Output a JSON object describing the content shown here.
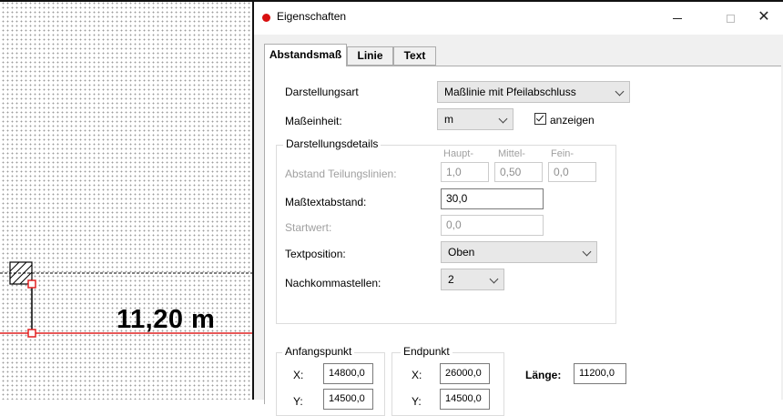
{
  "canvas": {
    "dimension_text": "11,20 m"
  },
  "dialog": {
    "title": "Eigenschaften",
    "icon": "red-dot-icon",
    "window_buttons": {
      "minimize": "–",
      "maximize": "□",
      "close": "✕"
    },
    "tabs": [
      {
        "label": "Abstandsmaß",
        "selected": true
      },
      {
        "label": "Linie",
        "selected": false
      },
      {
        "label": "Text",
        "selected": false
      }
    ],
    "darstellungsart": {
      "label": "Darstellungsart",
      "value": "Maßlinie mit Pfeilabschluss"
    },
    "masseinheit": {
      "label": "Maßeinheit:",
      "value": "m",
      "anzeigen_label": "anzeigen",
      "anzeigen_checked": true
    },
    "details": {
      "title": "Darstellungsdetails",
      "headers": {
        "haupt": "Haupt-",
        "mittel": "Mittel-",
        "fein": "Fein-"
      },
      "abstand_teilungslinien": {
        "label": "Abstand Teilungslinien:",
        "haupt": "1,0",
        "mittel": "0,50",
        "fein": "0,0"
      },
      "masstextabstand": {
        "label": "Maßtextabstand:",
        "value": "30,0"
      },
      "startwert": {
        "label": "Startwert:",
        "value": "0,0"
      },
      "textposition": {
        "label": "Textposition:",
        "value": "Oben"
      },
      "nachkommastellen": {
        "label": "Nachkommastellen:",
        "value": "2"
      }
    },
    "anfangspunkt": {
      "title": "Anfangspunkt",
      "x_label": "X:",
      "x": "14800,0",
      "y_label": "Y:",
      "y": "14500,0"
    },
    "endpunkt": {
      "title": "Endpunkt",
      "x_label": "X:",
      "x": "26000,0",
      "y_label": "Y:",
      "y": "14500,0"
    },
    "laenge": {
      "label": "Länge:",
      "value": "11200,0"
    }
  },
  "colors": {
    "accent_red": "#d81010",
    "dialog_bg": "#f0f0f0"
  }
}
